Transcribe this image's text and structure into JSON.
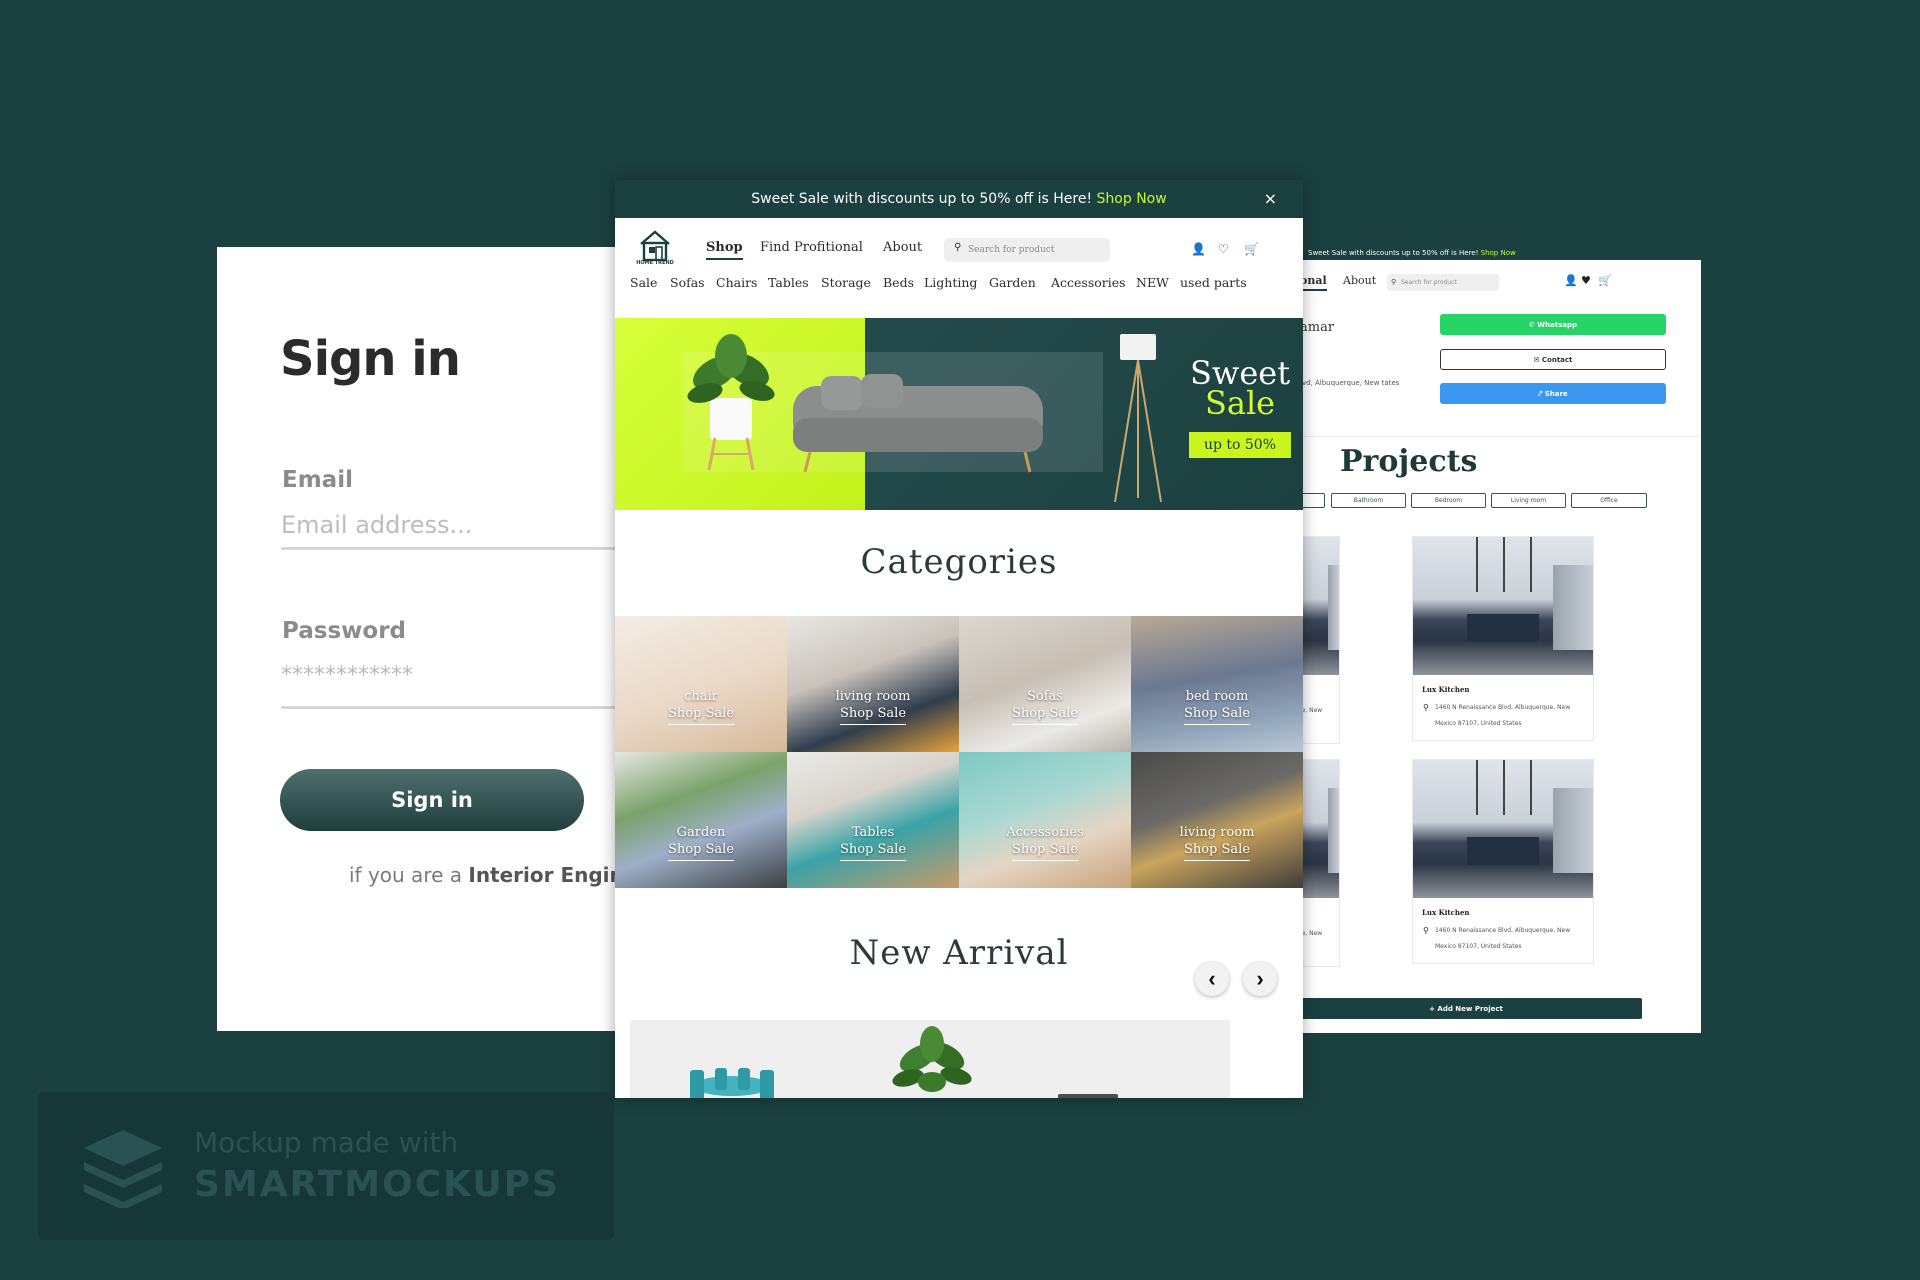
{
  "signin": {
    "title": "Sign in",
    "email_label": "Email",
    "email_placeholder": "Email address...",
    "password_label": "Password",
    "password_value": "************",
    "button": "Sign in",
    "footer_prefix": "if you are a ",
    "footer_bold": "Interior Enginee"
  },
  "shop": {
    "promo": {
      "text": "Sweet Sale with discounts up to 50% off is Here! ",
      "link": "Shop Now",
      "close": "×"
    },
    "logo_text": "HOME TREND",
    "top_nav": [
      "Shop",
      "Find Profitional",
      "About"
    ],
    "search_placeholder": "Search for product",
    "icons": [
      "user-icon",
      "heart-icon",
      "cart-icon"
    ],
    "categories_nav": [
      "Sale",
      "Sofas",
      "Chairs",
      "Tables",
      "Storage",
      "Beds",
      "Lighting",
      "Garden",
      "Accessories",
      "NEW",
      "used parts"
    ],
    "hero": {
      "line1": "Sweet",
      "line2": "Sale",
      "badge": "up to 50%"
    },
    "categories_title": "Categories",
    "tiles": [
      {
        "name": "chair",
        "cta": "Shop Sale"
      },
      {
        "name": "living room",
        "cta": "Shop Sale"
      },
      {
        "name": "Sofas",
        "cta": "Shop Sale"
      },
      {
        "name": "bed room",
        "cta": "Shop Sale"
      },
      {
        "name": "Garden",
        "cta": "Shop Sale"
      },
      {
        "name": "Tables",
        "cta": "Shop Sale"
      },
      {
        "name": "Accessories",
        "cta": "Shop Sale"
      },
      {
        "name": "living room",
        "cta": "Shop Sale"
      }
    ],
    "new_arrival_title": "New Arrival",
    "prev": "‹",
    "next": "›"
  },
  "profile": {
    "promo": {
      "text": "Sweet Sale with discounts up to 50% off is Here! ",
      "link": "Shop Now"
    },
    "nav": [
      "onal",
      "About"
    ],
    "search_placeholder": "Search for product",
    "name_fragment": "amar",
    "address_fragment": "lvd, Albuquerque, New tates",
    "buttons": {
      "whatsapp": "✆ Whatsapp",
      "contact": "✉ Contact",
      "share": "⤤ Share"
    },
    "projects_title": "Projects",
    "filters": [
      "",
      "Bathroom",
      "Bedroom",
      "Living room",
      "Office"
    ],
    "cards": [
      {
        "title": "Lux Kitchen",
        "address": "1460 N Renaissance Blvd, Albuquerque, New Mexico 87107, United States"
      },
      {
        "title": "Lux Kitchen",
        "address": "1460 N Renaissance Blvd, Albuquerque, New Mexico 87107, United States"
      }
    ],
    "partial_cards": [
      {
        "fragment": "que, New tes"
      },
      {
        "fragment": "que, New tes"
      }
    ],
    "add_button": "+ Add New Project"
  },
  "watermark": {
    "line1": "Mockup made with",
    "line2": "SMARTMOCKUPS"
  },
  "colors": {
    "brand_dark": "#1b4040",
    "accent_lime": "#c6f82b",
    "whatsapp": "#25d366",
    "share": "#3b97f0"
  }
}
